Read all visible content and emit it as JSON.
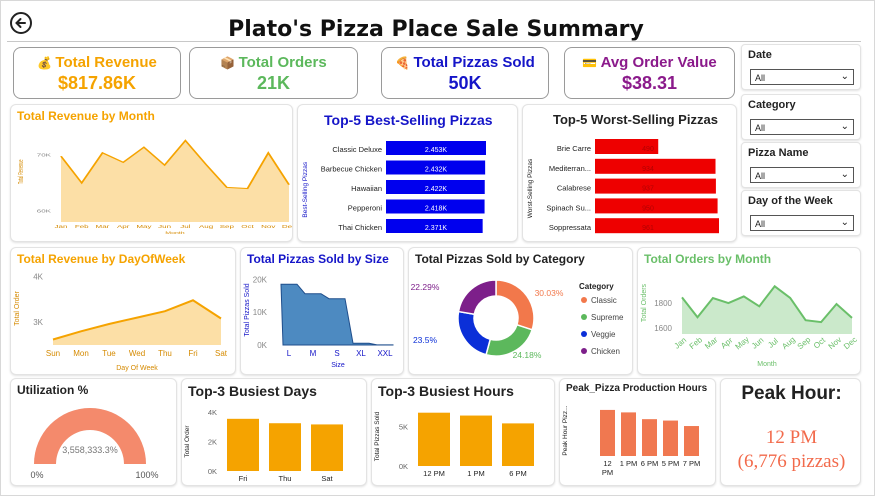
{
  "header": {
    "title": "Plato's Pizza Place Sale Summary",
    "back_icon": "back-arrow-icon"
  },
  "kpis": [
    {
      "icon": "💰",
      "label": "Total Revenue",
      "value": "$817.86K",
      "color": "#f5a300"
    },
    {
      "icon": "📦",
      "label": "Total Orders",
      "value": "21K",
      "color": "#5cb85c"
    },
    {
      "icon": "🍕",
      "label": "Total Pizzas Sold",
      "value": "50K",
      "color": "#1515c8"
    },
    {
      "icon": "💳",
      "label": "Avg Order Value",
      "value": "$38.31",
      "color": "#8b1a8b"
    }
  ],
  "slicers": [
    {
      "label": "Date",
      "value": "All"
    },
    {
      "label": "Category",
      "value": "All"
    },
    {
      "label": "Pizza Name",
      "value": "All"
    },
    {
      "label": "Day of the Week",
      "value": "All"
    }
  ],
  "chart_data": [
    {
      "id": "revenue_by_month",
      "type": "area",
      "title": "Total Revenue by Month",
      "xlabel": "Month",
      "ylabel": "Total Revenue",
      "categories": [
        "Jan",
        "Feb",
        "Mar",
        "Apr",
        "May",
        "Jun",
        "Jul",
        "Aug",
        "Sep",
        "Oct",
        "Nov",
        "Dec"
      ],
      "values": [
        69800,
        65000,
        70400,
        68700,
        71400,
        68200,
        72600,
        68300,
        64200,
        64000,
        70400,
        64700
      ],
      "yticks": [
        "70K",
        "60K"
      ],
      "ylim": [
        58000,
        76000
      ],
      "color": "#f5a300"
    },
    {
      "id": "top5_best",
      "type": "bar",
      "title": "Top-5 Best-Selling Pizzas",
      "ylabel": "Best-Selling Pizzas",
      "categories": [
        "Classic Deluxe",
        "Barbecue Chicken",
        "Hawaiian",
        "Pepperoni",
        "Thai Chicken"
      ],
      "values": [
        2453,
        2432,
        2422,
        2418,
        2371
      ],
      "labels": [
        "2.453K",
        "2.432K",
        "2.422K",
        "2.418K",
        "2.371K"
      ],
      "color": "#0000ee"
    },
    {
      "id": "top5_worst",
      "type": "bar",
      "title": "Top-5 Worst-Selling Pizzas",
      "ylabel": "Worst-Selling Pizzas",
      "categories": [
        "Brie Carre",
        "Mediterran...",
        "Calabrese",
        "Spinach Su...",
        "Soppressata"
      ],
      "values": [
        490,
        934,
        937,
        950,
        961
      ],
      "labels": [
        "490",
        "934",
        "937",
        "950",
        "961"
      ],
      "color": "#ee0000"
    },
    {
      "id": "revenue_by_dow",
      "type": "area",
      "title": "Total Revenue by DayOfWeek",
      "xlabel": "Day Of Week",
      "ylabel": "Total Order",
      "categories": [
        "Sun",
        "Mon",
        "Tue",
        "Wed",
        "Thu",
        "Fri",
        "Sat"
      ],
      "values": [
        2620,
        2800,
        2960,
        3100,
        3240,
        3480,
        3080
      ],
      "yticks": [
        "4K",
        "3K"
      ],
      "ylim": [
        2500,
        4100
      ],
      "color": "#f5a300"
    },
    {
      "id": "pizzas_by_size",
      "type": "area",
      "title": "Total Pizzas Sold by Size",
      "xlabel": "Size",
      "ylabel": "Total Pizzas Sold",
      "categories": [
        "L",
        "M",
        "S",
        "XL",
        "XXL"
      ],
      "values": [
        18500,
        15600,
        14100,
        540,
        28
      ],
      "yticks": [
        "20K",
        "10K",
        "0K"
      ],
      "ylim": [
        0,
        21000
      ],
      "color": "#2e75b6"
    },
    {
      "id": "pizzas_by_category",
      "type": "pie",
      "title": "Total Pizzas Sold by Category",
      "legend_title": "Category",
      "slices": [
        {
          "name": "Classic",
          "value": 30.03,
          "label": "30.03%",
          "color": "#f2784b"
        },
        {
          "name": "Supreme",
          "value": 24.18,
          "label": "24.18%",
          "color": "#5cb85c"
        },
        {
          "name": "Veggie",
          "value": 23.5,
          "label": "23.5%",
          "color": "#0b2fd8"
        },
        {
          "name": "Chicken",
          "value": 22.29,
          "label": "22.29%",
          "color": "#7d1f8a"
        }
      ]
    },
    {
      "id": "orders_by_month",
      "type": "area",
      "title": "Total Orders by Month",
      "xlabel": "Month",
      "ylabel": "Total Orders",
      "categories": [
        "Jan",
        "Feb",
        "Mar",
        "Apr",
        "May",
        "Jun",
        "Jul",
        "Aug",
        "Sep",
        "Oct",
        "Nov",
        "Dec"
      ],
      "values": [
        1845,
        1685,
        1840,
        1799,
        1853,
        1773,
        1935,
        1841,
        1661,
        1646,
        1792,
        1680
      ],
      "yticks": [
        "1800",
        "1600"
      ],
      "ylim": [
        1550,
        2050
      ],
      "color": "#6abf69"
    },
    {
      "id": "busiest_days",
      "type": "bar",
      "title": "Top-3 Busiest Days",
      "ylabel": "Total Order",
      "categories": [
        "Fri",
        "Thu",
        "Sat"
      ],
      "values": [
        3538,
        3239,
        3158
      ],
      "yticks": [
        "4K",
        "2K",
        "0K"
      ],
      "ylim": [
        0,
        4000
      ],
      "color": "#f5a300"
    },
    {
      "id": "busiest_hours",
      "type": "bar",
      "title": "Top-3 Busiest Hours",
      "ylabel": "Total Pizzas Sold",
      "categories": [
        "12 PM",
        "1 PM",
        "6 PM"
      ],
      "values": [
        6776,
        6413,
        5417
      ],
      "yticks": [
        "5K",
        "0K"
      ],
      "ylim": [
        0,
        7500
      ],
      "color": "#f5a300"
    },
    {
      "id": "peak_production_hours",
      "type": "bar",
      "title": "Peak_Pizza Production Hours",
      "ylabel": "Peak Hour Pizz...",
      "categories": [
        "12 PM",
        "1 PM",
        "6 PM",
        "5 PM",
        "7 PM"
      ],
      "values": [
        6776,
        6413,
        5417,
        5211,
        4406
      ],
      "ylim": [
        0,
        7500
      ],
      "color": "#f07850"
    },
    {
      "id": "utilization",
      "type": "gauge",
      "title": "Utilization %",
      "value_label": "3,558,333.3%",
      "min_label": "0%",
      "max_label": "100%",
      "fill": 1.0,
      "color": "#f48a6c"
    }
  ],
  "peak_hour": {
    "title": "Peak Hour:",
    "line1": "12 PM",
    "line2": "(6,776 pizzas)",
    "color": "#f26a4b"
  }
}
